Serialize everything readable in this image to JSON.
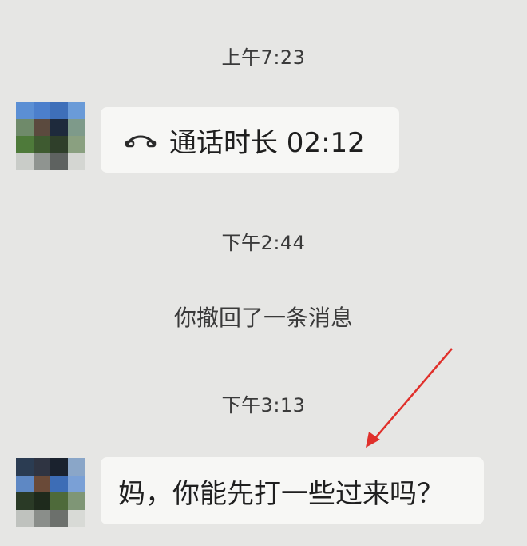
{
  "messages": {
    "time1": "上午7:23",
    "call_text": "通话时长 02:12",
    "time2": "下午2:44",
    "recall_note": "你撤回了一条消息",
    "time3": "下午3:13",
    "last_message": "妈，你能先打一些过来吗？"
  },
  "icons": {
    "call": "phone-handset-icon"
  },
  "colors": {
    "background": "#e6e6e4",
    "bubble": "#f7f7f5",
    "annotation_arrow": "#e0302b"
  }
}
